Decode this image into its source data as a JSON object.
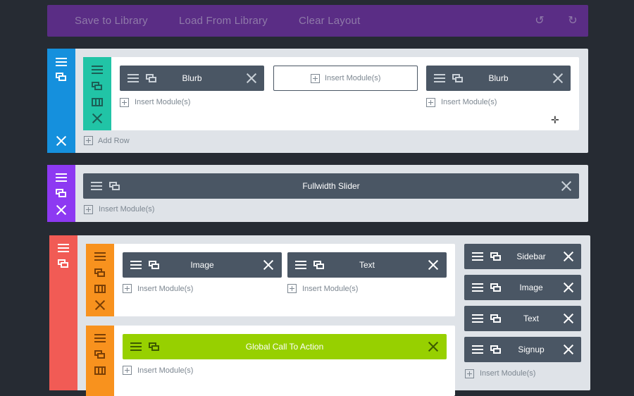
{
  "toolbar": {
    "save": "Save to Library",
    "load": "Load From Library",
    "clear": "Clear Layout",
    "undo_icon": "undo-icon",
    "redo_icon": "redo-icon"
  },
  "labels": {
    "insert_modules": "Insert Module(s)",
    "add_row": "Add Row"
  },
  "colors": {
    "toolbar": "#5a2d85",
    "section_blue": "#1590dd",
    "section_purple": "#8d39f2",
    "section_red": "#f15b55",
    "row_teal": "#21c4a6",
    "row_orange": "#f8921e",
    "module_dark": "#4a5664",
    "module_green": "#97d000"
  },
  "section1": {
    "row1": {
      "col1": {
        "module": "Blurb"
      },
      "col2": {
        "module": ""
      },
      "col3": {
        "module": "Blurb"
      }
    }
  },
  "section2": {
    "module": "Fullwidth Slider"
  },
  "section3": {
    "row1": {
      "col1": {
        "module": "Image"
      },
      "col2": {
        "module": "Text"
      }
    },
    "row2": {
      "col1": {
        "module": "Global Call To Action"
      }
    },
    "sidebar": {
      "modules": [
        "Sidebar",
        "Image",
        "Text",
        "Signup"
      ]
    }
  }
}
